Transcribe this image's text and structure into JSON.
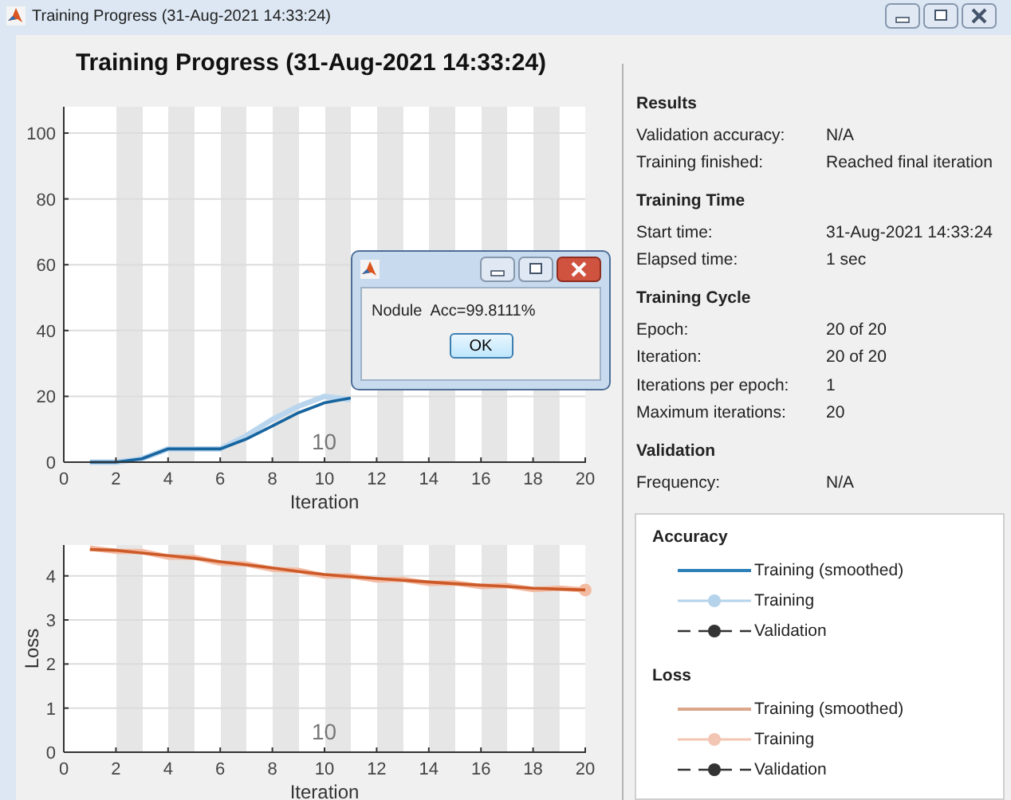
{
  "window": {
    "title": "Training Progress (31-Aug-2021 14:33:24)"
  },
  "heading": "Training Progress (31-Aug-2021 14:33:24)",
  "accuracy_plot": {
    "epoch_label": "10",
    "chart_data": {
      "type": "line",
      "xlabel": "Iteration",
      "x": [
        1,
        2,
        3,
        4,
        5,
        6,
        7,
        8,
        9,
        10,
        11
      ],
      "xlim": [
        0,
        20
      ],
      "ylim": [
        0,
        108
      ],
      "xticks": [
        0,
        2,
        4,
        6,
        8,
        10,
        12,
        14,
        16,
        18,
        20
      ],
      "yticks": [
        0,
        20,
        40,
        60,
        80,
        100
      ],
      "grid": true,
      "series": [
        {
          "color": "#b9d6ee",
          "values": [
            0,
            0,
            1,
            4,
            4,
            4,
            8,
            13,
            17,
            20,
            19
          ]
        },
        {
          "color": "#17649e",
          "values": [
            0,
            0,
            1,
            4,
            4,
            4,
            7,
            11,
            15,
            18,
            19.5
          ]
        }
      ]
    }
  },
  "loss_plot": {
    "epoch_label": "10",
    "chart_data": {
      "type": "line",
      "xlabel": "Iteration",
      "ylabel": "Loss",
      "x": [
        1,
        2,
        3,
        4,
        5,
        6,
        7,
        8,
        9,
        10,
        11,
        12,
        13,
        14,
        15,
        16,
        17,
        18,
        19,
        20
      ],
      "xlim": [
        0,
        20
      ],
      "ylim": [
        0,
        4.7
      ],
      "xticks": [
        0,
        2,
        4,
        6,
        8,
        10,
        12,
        14,
        16,
        18,
        20
      ],
      "yticks": [
        0,
        1,
        2,
        3,
        4
      ],
      "grid": true,
      "series": [
        {
          "color": "#f4bba3",
          "values": [
            4.63,
            4.56,
            4.55,
            4.43,
            4.42,
            4.29,
            4.27,
            4.15,
            4.12,
            4.0,
            4.0,
            3.91,
            3.92,
            3.83,
            3.84,
            3.76,
            3.78,
            3.69,
            3.72,
            3.68
          ]
        },
        {
          "color": "#cc5a28",
          "values": [
            4.6,
            4.58,
            4.52,
            4.46,
            4.4,
            4.32,
            4.25,
            4.18,
            4.1,
            4.03,
            3.98,
            3.94,
            3.9,
            3.86,
            3.82,
            3.79,
            3.76,
            3.72,
            3.7,
            3.68
          ]
        }
      ]
    }
  },
  "sections": [
    {
      "title": "Results",
      "rows": [
        {
          "label": "Validation accuracy:",
          "value": "N/A"
        },
        {
          "label": "Training finished:",
          "value": "Reached final iteration"
        }
      ]
    },
    {
      "title": "Training Time",
      "rows": [
        {
          "label": "Start time:",
          "value": "31-Aug-2021 14:33:24"
        },
        {
          "label": "Elapsed time:",
          "value": "1 sec"
        }
      ]
    },
    {
      "title": "Training Cycle",
      "rows": [
        {
          "label": "Epoch:",
          "value": "20 of 20"
        },
        {
          "label": "Iteration:",
          "value": "20 of 20"
        },
        {
          "label": "Iterations per epoch:",
          "value": "1"
        },
        {
          "label": "Maximum iterations:",
          "value": "20"
        }
      ]
    },
    {
      "title": "Validation",
      "rows": [
        {
          "label": "Frequency:",
          "value": "N/A"
        }
      ]
    }
  ],
  "legend": [
    {
      "title": "Accuracy",
      "items": [
        {
          "kind": "line",
          "label": "Training (smoothed)",
          "color": "#2f7fb8"
        },
        {
          "kind": "marker",
          "label": "Training",
          "color": "#b4d3ea"
        },
        {
          "kind": "dashed-marker",
          "label": "Validation",
          "color": "#333333"
        }
      ]
    },
    {
      "title": "Loss",
      "items": [
        {
          "kind": "line",
          "label": "Training (smoothed)",
          "color": "#dba68a"
        },
        {
          "kind": "marker",
          "label": "Training",
          "color": "#f2c6b2"
        },
        {
          "kind": "dashed-marker",
          "label": "Validation",
          "color": "#333333"
        }
      ]
    }
  ],
  "dialog": {
    "message": "Nodule  Acc=99.8111%",
    "button": "OK"
  }
}
